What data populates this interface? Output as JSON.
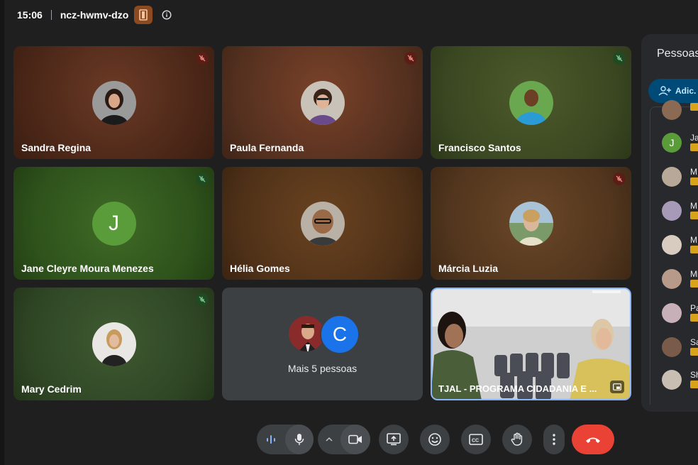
{
  "header": {
    "time": "15:06",
    "meeting_code": "ncz-hwmv-dzo"
  },
  "tiles": [
    {
      "name": "Sandra Regina",
      "mic": "muted-red"
    },
    {
      "name": "Paula Fernanda",
      "mic": "muted-red"
    },
    {
      "name": "Francisco Santos",
      "mic": "muted-green"
    },
    {
      "name": "Jane Cleyre Moura Menezes",
      "mic": "muted-green",
      "avatar_letter": "J"
    },
    {
      "name": "Hélia Gomes",
      "mic": "none"
    },
    {
      "name": "Márcia Luzia",
      "mic": "muted-red"
    },
    {
      "name": "Mary Cedrim",
      "mic": "muted-green"
    },
    {
      "name": "Mais 5 pessoas",
      "avatar_letter": "C"
    },
    {
      "name": "TJAL - PROGRAMA CIDADANIA E ..."
    }
  ],
  "people_panel": {
    "title": "Pessoas",
    "add_label": "Adic.",
    "list": [
      {
        "name": "Ja",
        "avatar_letter": "J"
      },
      {
        "name": "M"
      },
      {
        "name": "M"
      },
      {
        "name": "M"
      },
      {
        "name": "Mi"
      },
      {
        "name": "Pa"
      },
      {
        "name": "Sa"
      },
      {
        "name": "Sh"
      }
    ]
  },
  "controls": {
    "buttons": [
      "audio-levels",
      "microphone",
      "more-options-caret",
      "camera",
      "present-screen",
      "reactions",
      "captions",
      "raise-hand",
      "more-options",
      "leave-call"
    ]
  },
  "colors": {
    "end_call": "#ea4335",
    "active_tile_border": "#8ab4f8",
    "add_button": "#004a77"
  }
}
